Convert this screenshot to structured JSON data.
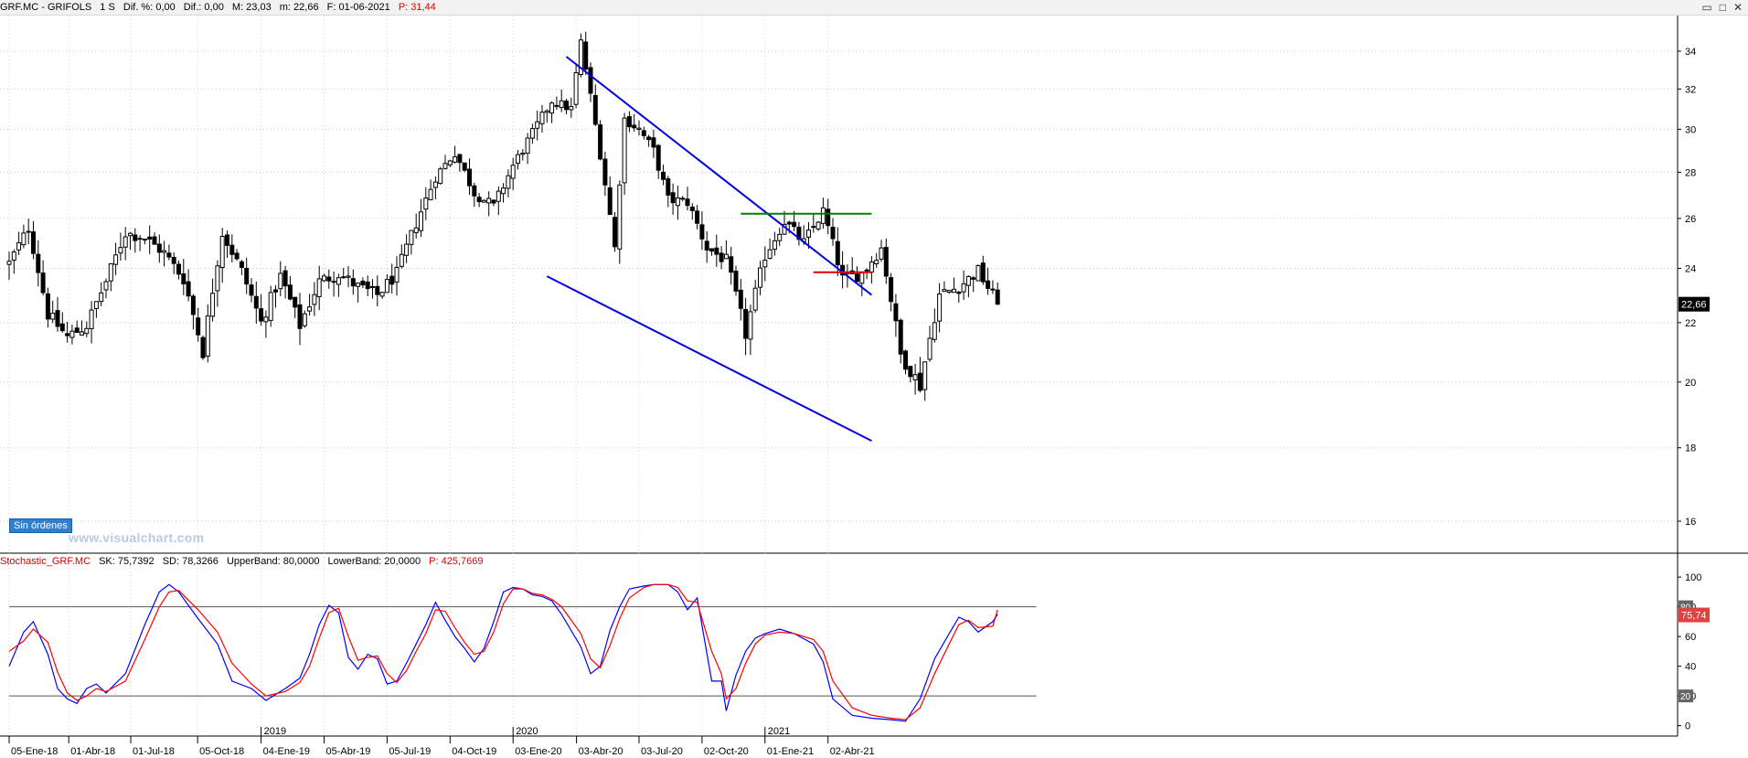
{
  "header": {
    "symbol": "GRF.MC - GRIFOLS",
    "timeframe": "1 S",
    "dif_pct": "Dif. %: 0,00",
    "dif": "Dif.: 0,00",
    "max": "M: 23,03",
    "min": "m: 22,66",
    "date": "F: 01-06-2021",
    "price": "P: 31,44"
  },
  "stoch_header": {
    "name": "Stochastic_GRF.MC",
    "sk": "SK: 75,7392",
    "sd": "SD: 78,3266",
    "upper": "UpperBand: 80,0000",
    "lower": "LowerBand: 20,0000",
    "price": "P: 425,7669"
  },
  "window_buttons": {
    "collapse": "▭",
    "expand": "□",
    "close": "✕"
  },
  "orders_badge": "Sin órdenes",
  "watermark": "www.visualchart.com",
  "colors": {
    "channel": "#0000e0",
    "resistance_green": "#008000",
    "resistance_red": "#e00000",
    "sk": "#0000ff",
    "sd": "#ff0000",
    "price_tag": "#000000",
    "stoch_tag": "#e04040"
  },
  "chart_data": [
    {
      "type": "candlestick",
      "title": "GRF.MC - GRIFOLS",
      "y_ticks": [
        34,
        32,
        30,
        28,
        26,
        24,
        22,
        20,
        18,
        16
      ],
      "y_scale": "log",
      "ylim": [
        15.2,
        36
      ],
      "current_label": "22,66",
      "x_tick_labels": [
        "05-Ene-18",
        "01-Abr-18",
        "01-Jul-18",
        "05-Oct-18",
        "04-Ene-19",
        "05-Abr-19",
        "05-Jul-19",
        "04-Oct-19",
        "03-Ene-20",
        "03-Abr-20",
        "03-Jul-20",
        "02-Oct-20",
        "01-Ene-21",
        "02-Abr-21"
      ],
      "year_labels": [
        "2019",
        "2020",
        "2021"
      ],
      "close_path": [
        [
          0,
          24.2
        ],
        [
          4,
          25.6
        ],
        [
          8,
          22.3
        ],
        [
          12,
          21.5
        ],
        [
          16,
          21.9
        ],
        [
          20,
          23.5
        ],
        [
          24,
          25.4
        ],
        [
          28,
          25.2
        ],
        [
          32,
          24.6
        ],
        [
          36,
          23.6
        ],
        [
          40,
          21.0
        ],
        [
          44,
          25.4
        ],
        [
          48,
          23.9
        ],
        [
          52,
          22.0
        ],
        [
          56,
          23.7
        ],
        [
          60,
          21.9
        ],
        [
          64,
          23.5
        ],
        [
          68,
          23.8
        ],
        [
          72,
          23.3
        ],
        [
          76,
          23.0
        ],
        [
          80,
          23.8
        ],
        [
          84,
          25.8
        ],
        [
          88,
          27.8
        ],
        [
          92,
          28.9
        ],
        [
          96,
          27.1
        ],
        [
          100,
          26.5
        ],
        [
          104,
          28.3
        ],
        [
          108,
          29.8
        ],
        [
          112,
          31.4
        ],
        [
          116,
          31.0
        ],
        [
          118,
          34.5
        ],
        [
          121,
          30.2
        ],
        [
          125,
          24.8
        ],
        [
          127,
          30.5
        ],
        [
          130,
          30.0
        ],
        [
          133,
          29.0
        ],
        [
          136,
          26.8
        ],
        [
          140,
          26.7
        ],
        [
          144,
          24.8
        ],
        [
          148,
          24.3
        ],
        [
          152,
          21.6
        ],
        [
          156,
          24.5
        ],
        [
          160,
          25.9
        ],
        [
          164,
          25.0
        ],
        [
          168,
          26.3
        ],
        [
          172,
          23.6
        ],
        [
          176,
          23.8
        ],
        [
          180,
          24.8
        ],
        [
          184,
          20.9
        ],
        [
          188,
          19.9
        ],
        [
          192,
          23.0
        ],
        [
          196,
          23.3
        ],
        [
          200,
          23.9
        ],
        [
          204,
          22.66
        ]
      ],
      "trendlines": [
        {
          "name": "channel-upper",
          "points": [
            [
              "2020-03-20",
              33.7
            ],
            [
              "2021-06-04",
              23.0
            ]
          ]
        },
        {
          "name": "channel-lower",
          "points": [
            [
              "2020-02-21",
              23.7
            ],
            [
              "2021-06-04",
              18.2
            ]
          ]
        },
        {
          "name": "resistance-green",
          "value": 26.2,
          "from": "2020-11-27",
          "to": "2021-06-04"
        },
        {
          "name": "resistance-red",
          "value": 23.85,
          "from": "2021-03-12",
          "to": "2021-06-04"
        }
      ]
    },
    {
      "type": "line",
      "title": "Stochastic_GRF.MC",
      "y_ticks": [
        100,
        80,
        60,
        40,
        20,
        0
      ],
      "ylim": [
        -7,
        105
      ],
      "bands": [
        80,
        20
      ],
      "tag_upper": "80",
      "tag_lower": "20",
      "tag_current": "75,74",
      "series": [
        {
          "name": "SK",
          "points": [
            [
              0,
              40
            ],
            [
              3,
              63
            ],
            [
              5,
              70
            ],
            [
              8,
              48
            ],
            [
              10,
              25
            ],
            [
              12,
              18
            ],
            [
              14,
              15
            ],
            [
              16,
              25
            ],
            [
              18,
              28
            ],
            [
              20,
              22
            ],
            [
              24,
              35
            ],
            [
              28,
              68
            ],
            [
              31,
              90
            ],
            [
              33,
              95
            ],
            [
              35,
              90
            ],
            [
              39,
              72
            ],
            [
              43,
              55
            ],
            [
              46,
              30
            ],
            [
              50,
              25
            ],
            [
              53,
              17
            ],
            [
              57,
              25
            ],
            [
              60,
              32
            ],
            [
              62,
              48
            ],
            [
              64,
              68
            ],
            [
              66,
              81
            ],
            [
              68,
              76
            ],
            [
              70,
              46
            ],
            [
              72,
              38
            ],
            [
              74,
              48
            ],
            [
              76,
              45
            ],
            [
              78,
              28
            ],
            [
              80,
              30
            ],
            [
              82,
              42
            ],
            [
              84,
              55
            ],
            [
              86,
              68
            ],
            [
              88,
              83
            ],
            [
              90,
              71
            ],
            [
              92,
              60
            ],
            [
              94,
              52
            ],
            [
              96,
              43
            ],
            [
              98,
              52
            ],
            [
              100,
              70
            ],
            [
              102,
              90
            ],
            [
              104,
              93
            ],
            [
              106,
              92
            ],
            [
              108,
              88
            ],
            [
              110,
              87
            ],
            [
              112,
              84
            ],
            [
              114,
              75
            ],
            [
              118,
              53
            ],
            [
              120,
              35
            ],
            [
              122,
              40
            ],
            [
              124,
              64
            ],
            [
              126,
              80
            ],
            [
              128,
              92
            ],
            [
              131,
              94
            ],
            [
              133,
              95
            ],
            [
              136,
              95
            ],
            [
              138,
              90
            ],
            [
              140,
              78
            ],
            [
              142,
              86
            ],
            [
              145,
              30
            ],
            [
              147,
              30
            ],
            [
              148,
              10
            ],
            [
              150,
              34
            ],
            [
              152,
              50
            ],
            [
              154,
              59
            ],
            [
              156,
              62
            ],
            [
              159,
              65
            ],
            [
              162,
              62
            ],
            [
              166,
              55
            ],
            [
              168,
              43
            ],
            [
              170,
              18
            ],
            [
              174,
              7
            ],
            [
              178,
              5
            ],
            [
              182,
              4
            ],
            [
              185,
              3
            ],
            [
              188,
              18
            ],
            [
              191,
              45
            ],
            [
              194,
              62
            ],
            [
              196,
              73
            ],
            [
              198,
              70
            ],
            [
              200,
              63
            ],
            [
              203,
              70
            ],
            [
              204,
              75
            ]
          ]
        },
        {
          "name": "SD",
          "points": [
            [
              0,
              50
            ],
            [
              3,
              57
            ],
            [
              5,
              65
            ],
            [
              8,
              56
            ],
            [
              10,
              36
            ],
            [
              12,
              22
            ],
            [
              14,
              17
            ],
            [
              16,
              20
            ],
            [
              18,
              25
            ],
            [
              20,
              23
            ],
            [
              24,
              30
            ],
            [
              28,
              58
            ],
            [
              31,
              80
            ],
            [
              33,
              90
            ],
            [
              35,
              91
            ],
            [
              39,
              78
            ],
            [
              43,
              63
            ],
            [
              46,
              42
            ],
            [
              50,
              28
            ],
            [
              53,
              20
            ],
            [
              57,
              23
            ],
            [
              60,
              29
            ],
            [
              62,
              40
            ],
            [
              64,
              59
            ],
            [
              66,
              76
            ],
            [
              68,
              79
            ],
            [
              70,
              60
            ],
            [
              72,
              44
            ],
            [
              74,
              46
            ],
            [
              76,
              47
            ],
            [
              78,
              35
            ],
            [
              80,
              29
            ],
            [
              82,
              37
            ],
            [
              84,
              50
            ],
            [
              86,
              62
            ],
            [
              88,
              78
            ],
            [
              90,
              77
            ],
            [
              92,
              66
            ],
            [
              94,
              56
            ],
            [
              96,
              48
            ],
            [
              98,
              50
            ],
            [
              100,
              63
            ],
            [
              102,
              82
            ],
            [
              104,
              92
            ],
            [
              106,
              92
            ],
            [
              108,
              89
            ],
            [
              110,
              88
            ],
            [
              112,
              85
            ],
            [
              114,
              80
            ],
            [
              118,
              62
            ],
            [
              120,
              45
            ],
            [
              122,
              39
            ],
            [
              124,
              54
            ],
            [
              126,
              72
            ],
            [
              128,
              86
            ],
            [
              131,
              93
            ],
            [
              133,
              95
            ],
            [
              136,
              95
            ],
            [
              138,
              93
            ],
            [
              140,
              84
            ],
            [
              142,
              83
            ],
            [
              145,
              50
            ],
            [
              147,
              35
            ],
            [
              148,
              18
            ],
            [
              150,
              25
            ],
            [
              152,
              42
            ],
            [
              154,
              55
            ],
            [
              156,
              61
            ],
            [
              159,
              63
            ],
            [
              162,
              62
            ],
            [
              166,
              58
            ],
            [
              168,
              50
            ],
            [
              170,
              30
            ],
            [
              174,
              12
            ],
            [
              178,
              7
            ],
            [
              182,
              5
            ],
            [
              185,
              4
            ],
            [
              188,
              12
            ],
            [
              191,
              35
            ],
            [
              194,
              55
            ],
            [
              196,
              68
            ],
            [
              198,
              71
            ],
            [
              200,
              66
            ],
            [
              203,
              67
            ],
            [
              204,
              78
            ]
          ]
        }
      ]
    }
  ]
}
